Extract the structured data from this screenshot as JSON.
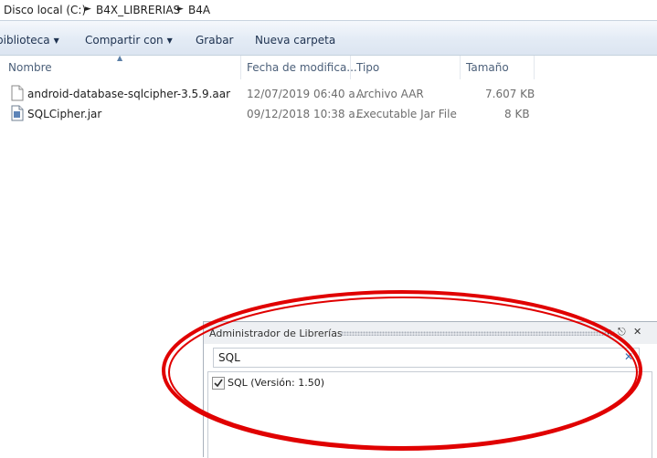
{
  "breadcrumb": {
    "items": [
      "Disco local (C:)",
      "B4X_LIBRERIAS",
      "B4A"
    ]
  },
  "toolbar": {
    "library_label": "biblioteca",
    "share_label": "Compartir con",
    "burn_label": "Grabar",
    "new_folder_label": "Nueva carpeta"
  },
  "columns": {
    "name": "Nombre",
    "date": "Fecha de modifica...",
    "type": "Tipo",
    "size": "Tamaño"
  },
  "files": [
    {
      "name": "android-database-sqlcipher-3.5.9.aar",
      "date": "12/07/2019 06:40 a...",
      "type": "Archivo AAR",
      "size": "7.607 KB",
      "icon": "document-file-icon"
    },
    {
      "name": "SQLCipher.jar",
      "date": "09/12/2018 10:38 a...",
      "type": "Executable Jar File",
      "size": "8 KB",
      "icon": "jar-file-icon"
    }
  ],
  "library_panel": {
    "title": "Administrador de Librerías",
    "search_value": "SQL",
    "libraries": [
      {
        "label": "SQL (Versión: 1.50)",
        "checked": true
      }
    ]
  },
  "colors": {
    "highlight_ellipse": "#e00000",
    "toolbar_text": "#1e3250",
    "header_text": "#4c607a"
  }
}
